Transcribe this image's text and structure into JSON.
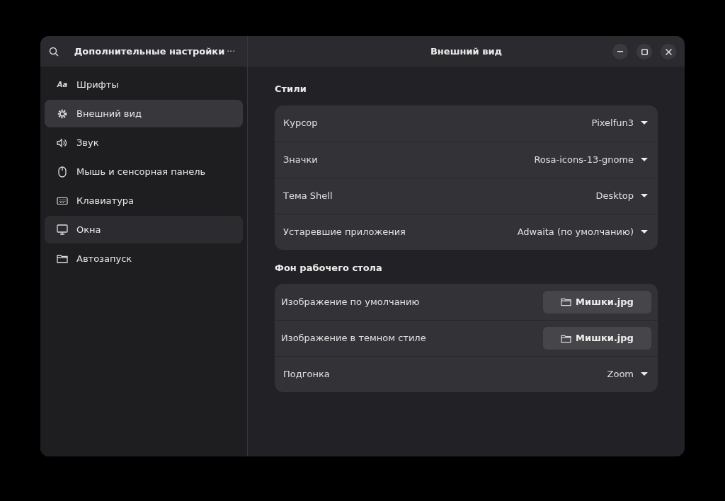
{
  "sidebar": {
    "title": "Дополнительные настройки",
    "menu_button": "···",
    "items": [
      {
        "label": "Шрифты",
        "glyph": "Aa",
        "selected": false,
        "hovered": false
      },
      {
        "label": "Внешний вид",
        "selected": true,
        "hovered": false
      },
      {
        "label": "Звук",
        "selected": false,
        "hovered": false
      },
      {
        "label": "Мышь и сенсорная панель",
        "selected": false,
        "hovered": false
      },
      {
        "label": "Клавиатура",
        "selected": false,
        "hovered": false
      },
      {
        "label": "Окна",
        "selected": false,
        "hovered": true
      },
      {
        "label": "Автозапуск",
        "selected": false,
        "hovered": false
      }
    ]
  },
  "window": {
    "title": "Внешний вид"
  },
  "sections": [
    {
      "title": "Стили",
      "rows": [
        {
          "kind": "dropdown",
          "label": "Курсор",
          "value": "Pixelfun3"
        },
        {
          "kind": "dropdown",
          "label": "Значки",
          "value": "Rosa-icons-13-gnome"
        },
        {
          "kind": "dropdown",
          "label": "Тема Shell",
          "value": "Desktop"
        },
        {
          "kind": "dropdown",
          "label": "Устаревшие приложения",
          "value": "Adwaita (по умолчанию)"
        }
      ]
    },
    {
      "title": "Фон рабочего стола",
      "rows": [
        {
          "kind": "file",
          "label": "Изображение по умолчанию",
          "value": "Мишки.jpg"
        },
        {
          "kind": "file",
          "label": "Изображение в темном стиле",
          "value": "Мишки.jpg"
        },
        {
          "kind": "dropdown",
          "label": "Подгонка",
          "value": "Zoom"
        }
      ]
    }
  ]
}
